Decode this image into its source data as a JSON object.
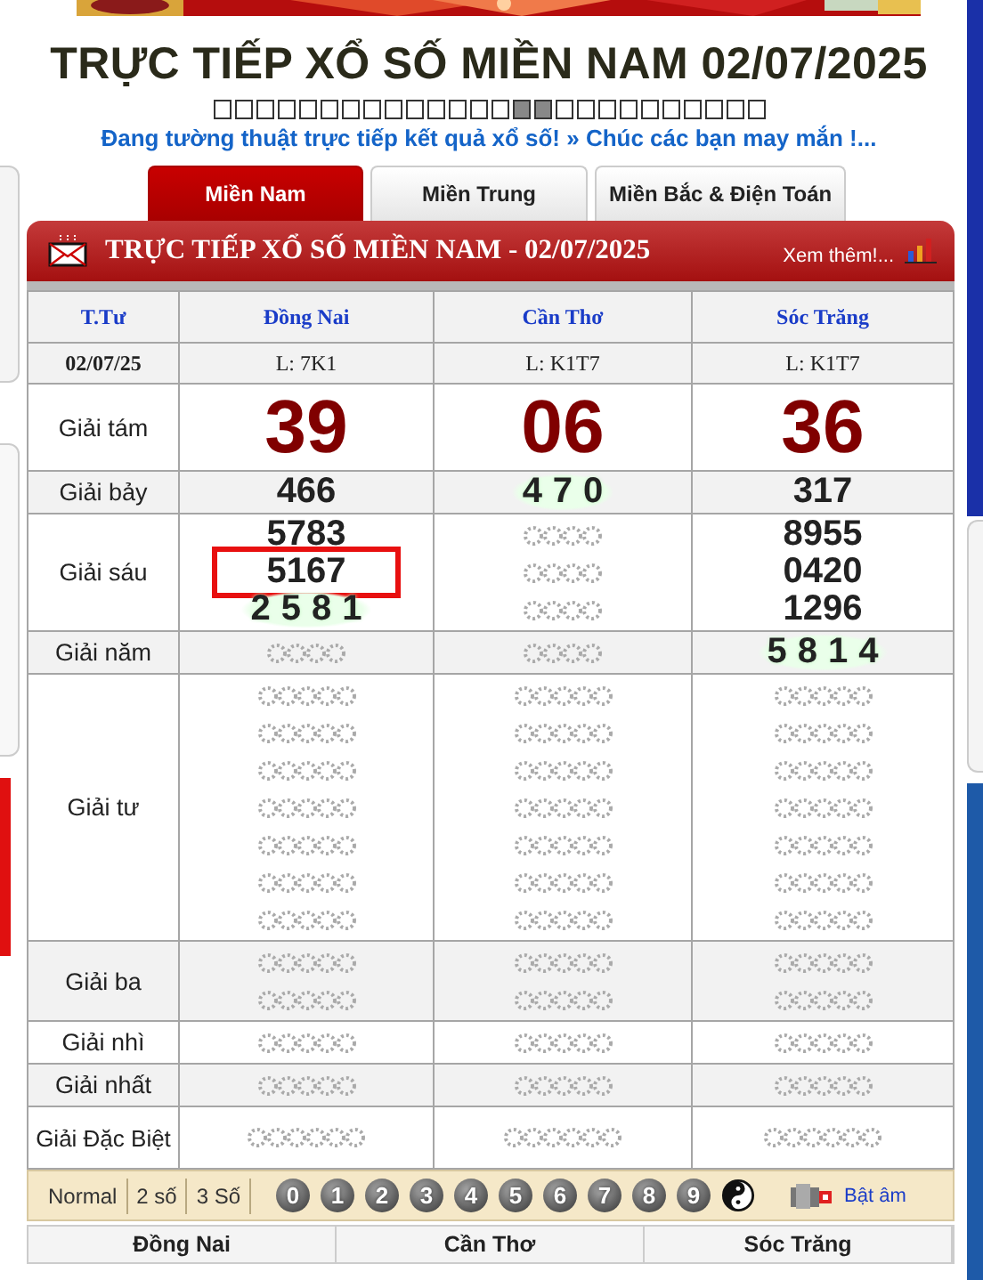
{
  "title": "TRỰC TIẾP XỔ SỐ MIỀN NAM 02/07/2025",
  "ticker_boxes": [
    {
      "filled": false
    },
    {
      "filled": false
    },
    {
      "filled": false
    },
    {
      "filled": false
    },
    {
      "filled": false
    },
    {
      "filled": false
    },
    {
      "filled": false
    },
    {
      "filled": false
    },
    {
      "filled": false
    },
    {
      "filled": false
    },
    {
      "filled": false
    },
    {
      "filled": false
    },
    {
      "filled": false
    },
    {
      "filled": false
    },
    {
      "filled": true
    },
    {
      "filled": true
    },
    {
      "filled": false
    },
    {
      "filled": false
    },
    {
      "filled": false
    },
    {
      "filled": false
    },
    {
      "filled": false
    },
    {
      "filled": false
    },
    {
      "filled": false
    },
    {
      "filled": false
    },
    {
      "filled": false
    },
    {
      "filled": false
    }
  ],
  "marquee": "Đang tường thuật trực tiếp kết quả xổ số! » Chúc các bạn may mắn !...",
  "tabs": [
    {
      "label": "Miền Nam",
      "selected": true
    },
    {
      "label": "Miền Trung",
      "selected": false
    },
    {
      "label": "Miền Bắc & Điện Toán",
      "selected": false
    }
  ],
  "results": {
    "title": "TRỰC TIẾP XỔ SỐ MIỀN NAM - 02/07/2025",
    "more_link": "Xem thêm!...",
    "corner_label": "T.Tư",
    "date": "02/07/25",
    "provinces": [
      {
        "name": "Đồng Nai",
        "ticket": "L: 7K1"
      },
      {
        "name": "Cần Thơ",
        "ticket": "L: K1T7"
      },
      {
        "name": "Sóc Trăng",
        "ticket": "L: K1T7"
      }
    ],
    "prizes": [
      {
        "name": "Giải tám",
        "kind": "big",
        "results": [
          [
            {
              "kind": "number",
              "text": "39"
            }
          ],
          [
            {
              "kind": "number",
              "text": "06"
            }
          ],
          [
            {
              "kind": "number",
              "text": "36"
            }
          ]
        ]
      },
      {
        "name": "Giải bảy",
        "kind": "normal",
        "results": [
          [
            {
              "kind": "number",
              "text": "466"
            }
          ],
          [
            {
              "kind": "rolling",
              "text": "470"
            }
          ],
          [
            {
              "kind": "number",
              "text": "317"
            }
          ]
        ]
      },
      {
        "name": "Giải sáu",
        "kind": "normal",
        "results": [
          [
            {
              "kind": "number",
              "text": "5783"
            },
            {
              "kind": "number",
              "text": "5167",
              "highlighted": true
            },
            {
              "kind": "rolling",
              "text": "2581"
            }
          ],
          [
            {
              "kind": "pending4"
            },
            {
              "kind": "pending4"
            },
            {
              "kind": "pending4"
            }
          ],
          [
            {
              "kind": "number",
              "text": "8955"
            },
            {
              "kind": "number",
              "text": "0420"
            },
            {
              "kind": "number",
              "text": "1296"
            }
          ]
        ]
      },
      {
        "name": "Giải năm",
        "kind": "normal",
        "results": [
          [
            {
              "kind": "pending4"
            }
          ],
          [
            {
              "kind": "pending4"
            }
          ],
          [
            {
              "kind": "rolling",
              "text": "5814"
            }
          ]
        ]
      },
      {
        "name": "Giải tư",
        "kind": "normal",
        "results": [
          [
            {
              "kind": "pending5"
            },
            {
              "kind": "pending5"
            },
            {
              "kind": "pending5"
            },
            {
              "kind": "pending5"
            },
            {
              "kind": "pending5"
            },
            {
              "kind": "pending5"
            },
            {
              "kind": "pending5"
            }
          ],
          [
            {
              "kind": "pending5"
            },
            {
              "kind": "pending5"
            },
            {
              "kind": "pending5"
            },
            {
              "kind": "pending5"
            },
            {
              "kind": "pending5"
            },
            {
              "kind": "pending5"
            },
            {
              "kind": "pending5"
            }
          ],
          [
            {
              "kind": "pending5"
            },
            {
              "kind": "pending5"
            },
            {
              "kind": "pending5"
            },
            {
              "kind": "pending5"
            },
            {
              "kind": "pending5"
            },
            {
              "kind": "pending5"
            },
            {
              "kind": "pending5"
            }
          ]
        ]
      },
      {
        "name": "Giải ba",
        "kind": "normal",
        "results": [
          [
            {
              "kind": "pending5"
            },
            {
              "kind": "pending5"
            }
          ],
          [
            {
              "kind": "pending5"
            },
            {
              "kind": "pending5"
            }
          ],
          [
            {
              "kind": "pending5"
            },
            {
              "kind": "pending5"
            }
          ]
        ]
      },
      {
        "name": "Giải nhì",
        "kind": "normal",
        "results": [
          [
            {
              "kind": "pending5"
            }
          ],
          [
            {
              "kind": "pending5"
            }
          ],
          [
            {
              "kind": "pending5"
            }
          ]
        ]
      },
      {
        "name": "Giải nhất",
        "kind": "normal",
        "results": [
          [
            {
              "kind": "pending5"
            }
          ],
          [
            {
              "kind": "pending5"
            }
          ],
          [
            {
              "kind": "pending5"
            }
          ]
        ]
      },
      {
        "name": "Giải Đặc Biệt",
        "kind": "special",
        "results": [
          [
            {
              "kind": "pending6"
            }
          ],
          [
            {
              "kind": "pending6"
            }
          ],
          [
            {
              "kind": "pending6"
            }
          ]
        ]
      }
    ]
  },
  "toolbar": {
    "modes": [
      "Normal",
      "2 số",
      "3 Số"
    ],
    "digits": [
      "0",
      "1",
      "2",
      "3",
      "4",
      "5",
      "6",
      "7",
      "8",
      "9"
    ],
    "sound_link": "Bật âm"
  },
  "bottom_header": [
    "Đồng Nai",
    "Cần Thơ",
    "Sóc Trăng"
  ]
}
